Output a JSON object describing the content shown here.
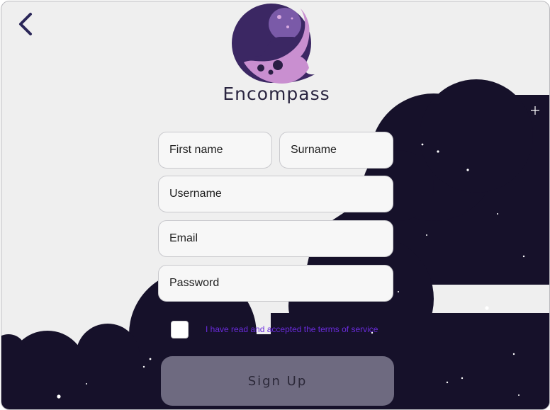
{
  "app": {
    "brand_name": "Encompass"
  },
  "colors": {
    "night_sky": "#16112a",
    "page_background": "#efefef",
    "logo_circle": "#3b2763",
    "logo_accent": "#c98fd0",
    "terms_link": "#6a2bdc",
    "button": "#6e6a80"
  },
  "icons": {
    "back": "chevron-left-icon",
    "logo": "encompass-logo-icon"
  },
  "form": {
    "first_name": {
      "placeholder": "First name",
      "value": ""
    },
    "surname": {
      "placeholder": "Surname",
      "value": ""
    },
    "username": {
      "placeholder": "Username",
      "value": ""
    },
    "email": {
      "placeholder": "Email",
      "value": ""
    },
    "password": {
      "placeholder": "Password",
      "value": ""
    },
    "terms": {
      "label": "I have read and accepted the terms of service",
      "checked": false
    },
    "submit_label": "Sign Up"
  }
}
